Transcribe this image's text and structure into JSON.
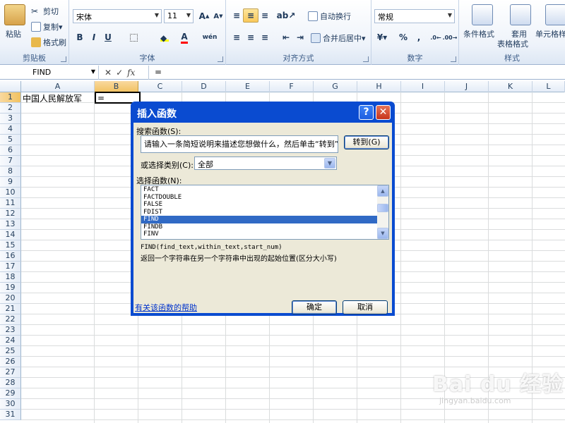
{
  "ribbon": {
    "clipboard": {
      "label": "剪贴板",
      "paste": "粘贴",
      "cut": "剪切",
      "copy": "复制",
      "format_painter": "格式刷"
    },
    "font": {
      "label": "字体",
      "font_name": "宋体",
      "font_size": "11",
      "bold": "B",
      "italic": "I",
      "underline": "U"
    },
    "alignment": {
      "label": "对齐方式",
      "wrap_text": "自动换行",
      "merge_center": "合并后居中"
    },
    "number": {
      "label": "数字",
      "format": "常规",
      "percent": "%",
      "comma": ","
    },
    "styles": {
      "label": "样式",
      "conditional_format": "条件格式",
      "table_format_top": "套用",
      "table_format_bottom": "表格格式",
      "cell_styles": "单元格样"
    }
  },
  "formula_bar": {
    "name_box": "FIND",
    "fx": "fx",
    "content": "="
  },
  "sheet": {
    "columns": [
      "A",
      "B",
      "C",
      "D",
      "E",
      "F",
      "G",
      "H",
      "I",
      "J",
      "K",
      "L"
    ],
    "rows": [
      "1",
      "2",
      "3",
      "4",
      "5",
      "6",
      "7",
      "8",
      "9",
      "10",
      "11",
      "12",
      "13",
      "14",
      "15",
      "16",
      "17",
      "18",
      "19",
      "20",
      "21",
      "22",
      "23",
      "24",
      "25",
      "26",
      "27",
      "28",
      "29",
      "30",
      "31"
    ],
    "cells": {
      "A1": "中国人民解放军",
      "B1": "="
    }
  },
  "dialog": {
    "title": "插入函数",
    "help_button": "?",
    "close_button": "✕",
    "search_label": "搜索函数(S):",
    "search_value": "请输入一条简短说明来描述您想做什么，然后单击“转到”",
    "go_button": "转到(G)",
    "category_label": "或选择类别(C):",
    "category_value": "全部",
    "function_label": "选择函数(N):",
    "functions": [
      "FACT",
      "FACTDOUBLE",
      "FALSE",
      "FDIST",
      "FIND",
      "FINDB",
      "FINV"
    ],
    "selected_function": "FIND",
    "signature": "FIND(find_text,within_text,start_num)",
    "description": "返回一个字符串在另一个字符串中出现的起始位置(区分大小写)",
    "help_link": "有关该函数的帮助",
    "ok_button": "确定",
    "cancel_button": "取消"
  },
  "watermark": {
    "text": "Bai du 经验",
    "url": "jingyan.baidu.com"
  }
}
